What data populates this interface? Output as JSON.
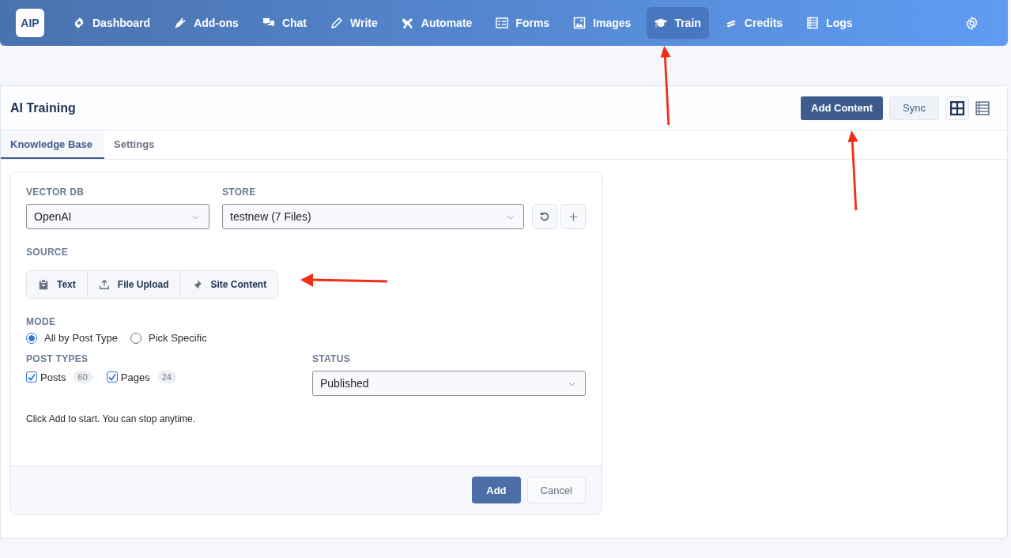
{
  "logo": "AIP",
  "nav": [
    {
      "label": "Dashboard",
      "selected": false
    },
    {
      "label": "Add-ons",
      "selected": false
    },
    {
      "label": "Chat",
      "selected": false
    },
    {
      "label": "Write",
      "selected": false
    },
    {
      "label": "Automate",
      "selected": false
    },
    {
      "label": "Forms",
      "selected": false
    },
    {
      "label": "Images",
      "selected": false
    },
    {
      "label": "Train",
      "selected": true
    },
    {
      "label": "Credits",
      "selected": false
    },
    {
      "label": "Logs",
      "selected": false
    }
  ],
  "page_title": "AI Training",
  "header_buttons": [
    {
      "label": "Add Content",
      "kind": "primary"
    },
    {
      "label": "Sync",
      "kind": "secondary"
    }
  ],
  "view_toggles": [
    {
      "selected": true
    },
    {
      "selected": false
    }
  ],
  "tabs": [
    {
      "label": "Knowledge Base",
      "selected": true
    },
    {
      "label": "Settings",
      "selected": false
    }
  ],
  "vector_db": {
    "label": "VECTOR DB",
    "value": "OpenAI"
  },
  "store": {
    "label": "STORE",
    "value": "testnew (7 Files)"
  },
  "source": {
    "label": "SOURCE",
    "options": [
      {
        "label": "Text"
      },
      {
        "label": "File Upload"
      },
      {
        "label": "Site Content"
      }
    ]
  },
  "mode": {
    "label": "MODE",
    "options": [
      {
        "label": "All by Post Type",
        "selected": true
      },
      {
        "label": "Pick Specific",
        "selected": false
      }
    ]
  },
  "post_types": {
    "label": "POST TYPES",
    "items": [
      {
        "label": "Posts",
        "count": "60",
        "checked": true
      },
      {
        "label": "Pages",
        "count": "24",
        "checked": true
      }
    ]
  },
  "status": {
    "label": "STATUS",
    "value": "Published"
  },
  "hint": "Click Add to start. You can stop anytime.",
  "footer_buttons": [
    {
      "label": "Add",
      "kind": "primary"
    },
    {
      "label": "Cancel",
      "kind": "secondary"
    }
  ]
}
